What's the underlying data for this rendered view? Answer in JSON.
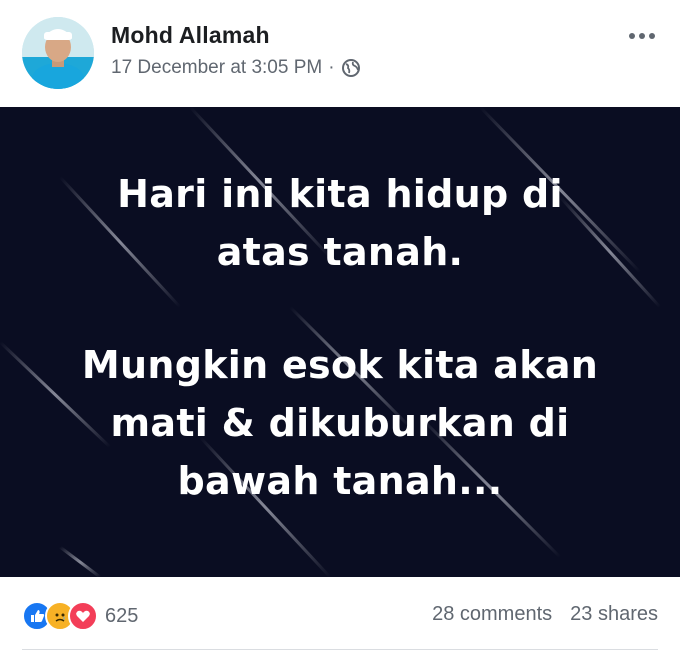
{
  "post": {
    "author": "Mohd Allamah",
    "timestamp": "17 December at 3:05 PM",
    "separator": "·",
    "privacy_icon": "globe-icon",
    "menu_icon": "more-options-icon"
  },
  "image": {
    "background_color": "#0a0d22",
    "lines": [
      "Hari ini kita hidup di",
      "atas tanah.",
      "Mungkin esok kita akan",
      "mati & dikuburkan di",
      "bawah tanah..."
    ]
  },
  "engagement": {
    "reactions": [
      "like-icon",
      "sad-icon",
      "love-icon"
    ],
    "reaction_count": "625",
    "comments": "28 comments",
    "shares": "23 shares"
  },
  "colors": {
    "like": "#1877f2",
    "sad": "#f7b125",
    "love": "#f33e58",
    "meta_text": "#606770"
  }
}
